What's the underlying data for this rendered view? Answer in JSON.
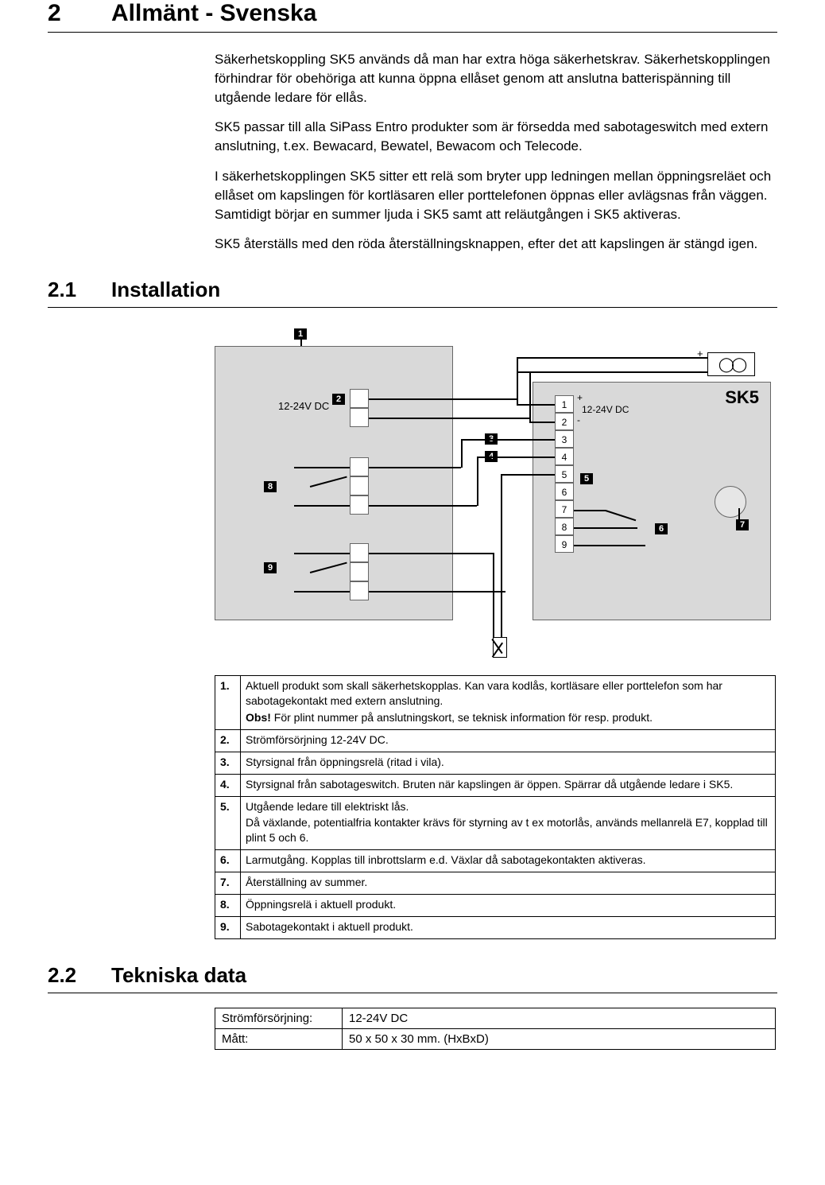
{
  "sections": {
    "main": {
      "number": "2",
      "title": "Allmänt - Svenska"
    },
    "sub1": {
      "number": "2.1",
      "title": "Installation"
    },
    "sub2": {
      "number": "2.2",
      "title": "Tekniska data"
    }
  },
  "paragraphs": {
    "p1": "Säkerhetskoppling SK5 används då man har extra höga säkerhetskrav. Säkerhetskopplingen förhindrar för obehöriga att kunna öppna ellåset genom att anslutna batterispänning till utgående ledare för ellås.",
    "p2": "SK5 passar till alla SiPass Entro produkter som är försedda med sabotageswitch med extern anslutning, t.ex. Bewacard, Bewatel, Bewacom och Telecode.",
    "p3": "I säkerhetskopplingen SK5 sitter ett relä som bryter upp ledningen mellan öppningsreläet och ellåset om kapslingen för kortläsaren eller porttelefonen öppnas eller avlägsnas från väggen. Samtidigt börjar en summer ljuda i SK5 samt att reläutgången i SK5 aktiveras.",
    "p4": "SK5 återställs med den röda återställningsknappen, efter det att kapslingen är stängd igen."
  },
  "diagram": {
    "label_12_24v": "12-24V DC",
    "label_sk5": "SK5",
    "plus": "+",
    "minus": "-",
    "callouts": {
      "c1": "1",
      "c2": "2",
      "c3": "3",
      "c4": "4",
      "c5": "5",
      "c6": "6",
      "c7": "7",
      "c8": "8",
      "c9": "9"
    },
    "terms_r": [
      "1",
      "2",
      "3",
      "4",
      "5",
      "6",
      "7",
      "8",
      "9"
    ]
  },
  "legend": [
    {
      "n": "1.",
      "lines": [
        "Aktuell produkt som skall säkerhetskopplas. Kan vara kodlås, kortläsare eller porttelefon som har sabotagekontakt med extern anslutning.",
        "<b>Obs!</b> För plint nummer på anslutningskort, se teknisk information för resp. produkt."
      ]
    },
    {
      "n": "2.",
      "lines": [
        "Strömförsörjning 12-24V DC."
      ]
    },
    {
      "n": "3.",
      "lines": [
        "Styrsignal från öppningsrelä (ritad i vila)."
      ]
    },
    {
      "n": "4.",
      "lines": [
        "Styrsignal från sabotageswitch. Bruten när kapslingen är öppen. Spärrar då utgående ledare i SK5."
      ]
    },
    {
      "n": "5.",
      "lines": [
        "Utgående ledare till elektriskt lås.",
        "Då växlande, potentialfria kontakter krävs för styrning av t ex motorlås, används mellanrelä E7, kopplad till plint 5 och 6."
      ]
    },
    {
      "n": "6.",
      "lines": [
        "Larmutgång. Kopplas till inbrottslarm e.d. Växlar då sabotagekontakten aktiveras."
      ]
    },
    {
      "n": "7.",
      "lines": [
        "Återställning av summer."
      ]
    },
    {
      "n": "8.",
      "lines": [
        "Öppningsrelä i aktuell produkt."
      ]
    },
    {
      "n": "9.",
      "lines": [
        "Sabotagekontakt i aktuell produkt."
      ]
    }
  ],
  "spec": [
    {
      "label": "Strömförsörjning:",
      "value": "12-24V DC"
    },
    {
      "label": "Mått:",
      "value": "50 x 50 x 30 mm. (HxBxD)"
    }
  ]
}
